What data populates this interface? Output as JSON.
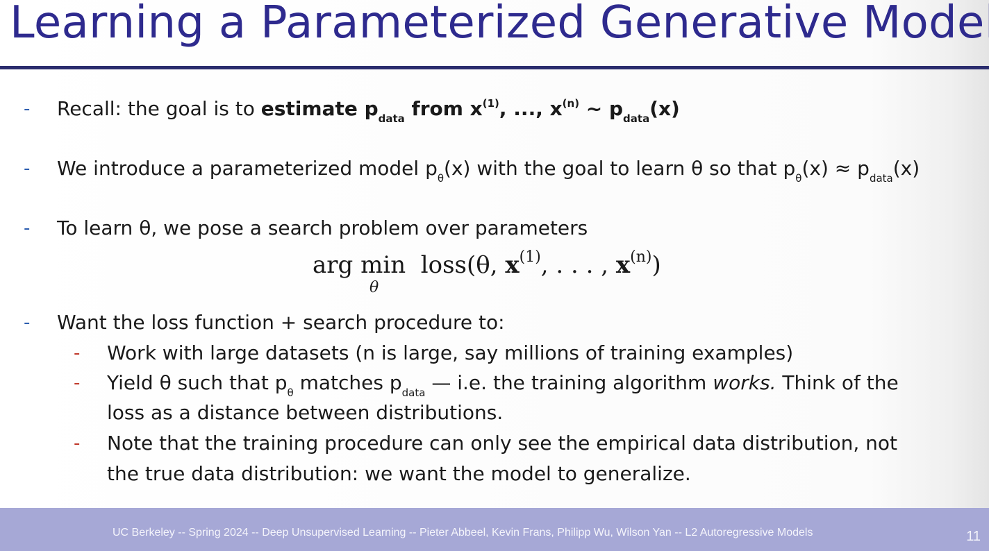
{
  "slide": {
    "title": "Learning a Parameterized Generative Model",
    "bullets": [
      {
        "dash": "-",
        "parts": [
          "Recall: the goal is to ",
          "estimate p",
          "data",
          " from x",
          "(1)",
          ", ..., x",
          "(n)",
          " ~ p",
          "data",
          "(x)"
        ]
      },
      {
        "dash": "-",
        "parts": [
          "We introduce a parameterized model p",
          "θ",
          "(x) with the goal to learn θ so that p",
          "θ",
          "(x) ≈ p",
          "data",
          "(x)"
        ]
      },
      {
        "dash": "-",
        "parts": [
          "To learn θ, we pose a search problem over parameters"
        ]
      },
      {
        "dash": "-",
        "parts": [
          "Want the loss function + search procedure to:"
        ]
      }
    ],
    "equation": {
      "argmin": "arg min",
      "under": "θ",
      "loss_open": "loss(θ, ",
      "x": "x",
      "sup1": "(1)",
      "middle": ", . . . , ",
      "supn": "(n)",
      "close": ")"
    },
    "sub_bullets": [
      {
        "dash": "-",
        "parts": [
          "Work with large datasets (n is large, say millions of training examples)"
        ]
      },
      {
        "dash": "-",
        "parts": [
          "Yield θ such that p",
          "θ",
          " matches p",
          "data",
          " — i.e. the training algorithm ",
          "works.",
          " Think of the"
        ],
        "continuation": "loss as a distance between distributions."
      },
      {
        "dash": "-",
        "parts": [
          "Note that the training procedure can only see the empirical data distribution, not"
        ],
        "continuation": "the true data distribution: we want the model to generalize."
      }
    ],
    "footer": "UC Berkeley -- Spring 2024 -- Deep Unsupervised Learning -- Pieter Abbeel, Kevin Frans, Philipp Wu, Wilson Yan -- L2 Autoregressive Models",
    "page_number": "11"
  },
  "colors": {
    "title": "#2e2a8e",
    "rule": "#2b2d6e",
    "dash_main": "#2e5fb0",
    "dash_sub": "#c0392b",
    "footer_bg": "#a6a8d6"
  }
}
